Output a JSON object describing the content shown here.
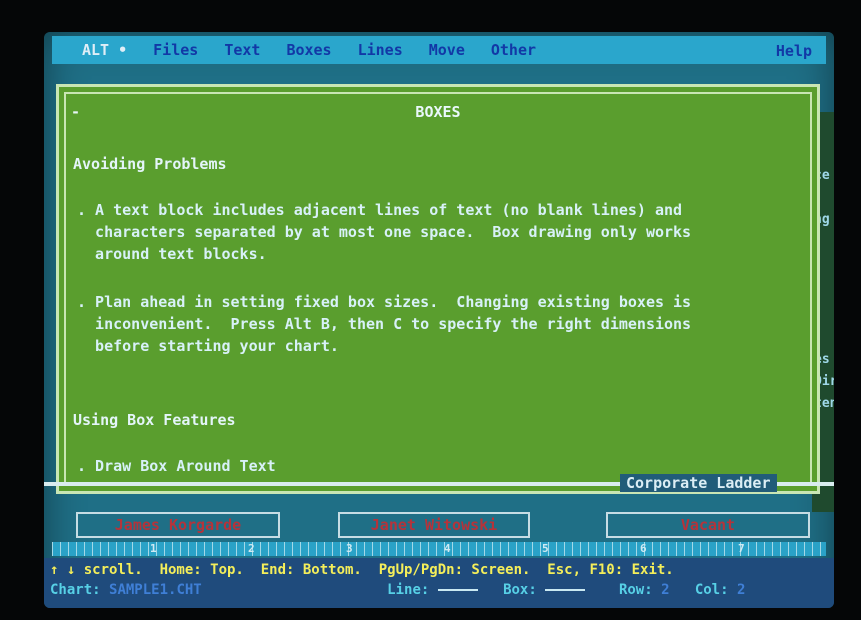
{
  "menu": {
    "items": [
      "ALT •",
      "Files",
      "Text",
      "Boxes",
      "Lines",
      "Move",
      "Other"
    ],
    "help_label": "Help"
  },
  "help_window": {
    "dash": "-",
    "title": "BOXES",
    "section1_heading": "Avoiding Problems",
    "para1": ". A text block includes adjacent lines of text (no blank lines) and\n  characters separated by at most one space.  Box drawing only works\n  around text blocks.",
    "para2": ". Plan ahead in setting fixed box sizes.  Changing existing boxes is\n  inconvenient.  Press Alt B, then C to specify the right dimensions\n  before starting your chart.",
    "section2_heading": "Using Box Features",
    "bullet_draw": ". Draw Box Around Text",
    "caption": "Corporate Ladder"
  },
  "background_fragments": [
    "ce",
    "ng",
    "es",
    "Dir",
    "ten"
  ],
  "org_chart": {
    "boxes": [
      "James Korgarde",
      "Janet Witowski",
      "Vacant"
    ]
  },
  "ruler": {
    "numbers": [
      "1",
      "2",
      "3",
      "4",
      "5",
      "6",
      "7"
    ]
  },
  "status": {
    "line1": "↑ ↓ scroll.  Home: Top.  End: Bottom.  PgUp/PgDn: Screen.  Esc, F10: Exit.",
    "chart_label": "Chart:",
    "chart_file": "SAMPLE1.CHT",
    "line_label": "Line:",
    "box_label": "Box:",
    "row_label": "Row:",
    "row_value": "2",
    "col_label": "Col:",
    "col_value": "2"
  },
  "colors": {
    "menu_bar": "#2aa6cc",
    "window_bg": "#5a9e2e",
    "status_bg": "#1f4b7c",
    "scroll_hint": "#f4ee5a"
  }
}
